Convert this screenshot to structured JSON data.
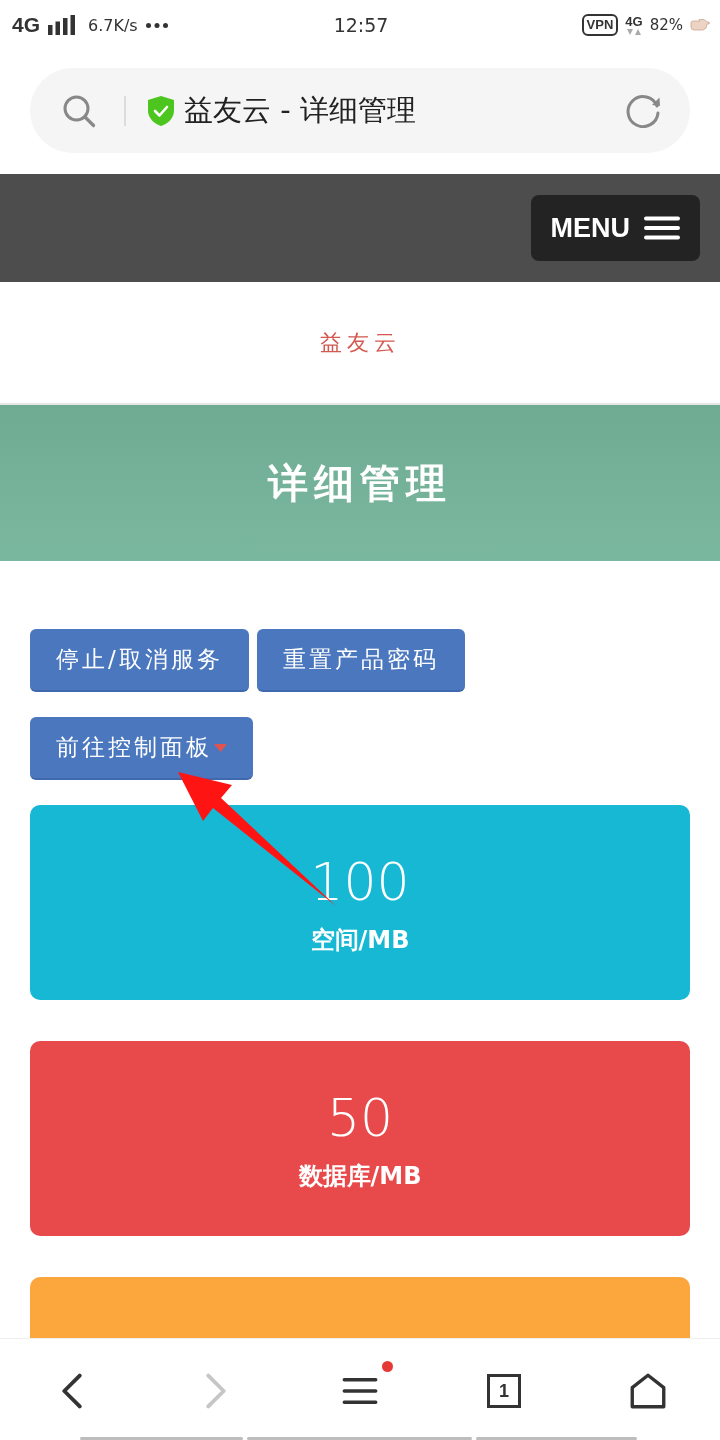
{
  "status_bar": {
    "network": "4G",
    "speed": "6.7K/s",
    "time": "12:57",
    "vpn": "VPN",
    "network_2": "4G",
    "battery": "82%"
  },
  "address_bar": {
    "title": "益友云 - 详细管理",
    "secure": true
  },
  "header": {
    "menu_button": {
      "label": "MENU"
    }
  },
  "brand": "益友云",
  "banner": {
    "title": "详细管理"
  },
  "buttons": [
    {
      "label": "停止/取消服务"
    },
    {
      "label": "重置产品密码"
    }
  ],
  "dropdown": {
    "label": "前往控制面板"
  },
  "stats": [
    {
      "value": "100",
      "label": "空间/MB",
      "color": "#17b8d4"
    },
    {
      "value": "50",
      "label": "数据库/MB",
      "color": "#e84a4b"
    },
    {
      "color": "#fca73d"
    }
  ],
  "annotations": [
    {
      "kind": "arrow"
    }
  ],
  "bottom_nav": [
    {
      "kind": "back",
      "disabled": false,
      "badge": false
    },
    {
      "kind": "forward",
      "disabled": true,
      "badge": false
    },
    {
      "kind": "menu",
      "disabled": false,
      "badge": true
    },
    {
      "kind": "tabs",
      "disabled": false,
      "badge": false,
      "count": "1"
    },
    {
      "kind": "home",
      "disabled": false,
      "badge": false
    }
  ]
}
